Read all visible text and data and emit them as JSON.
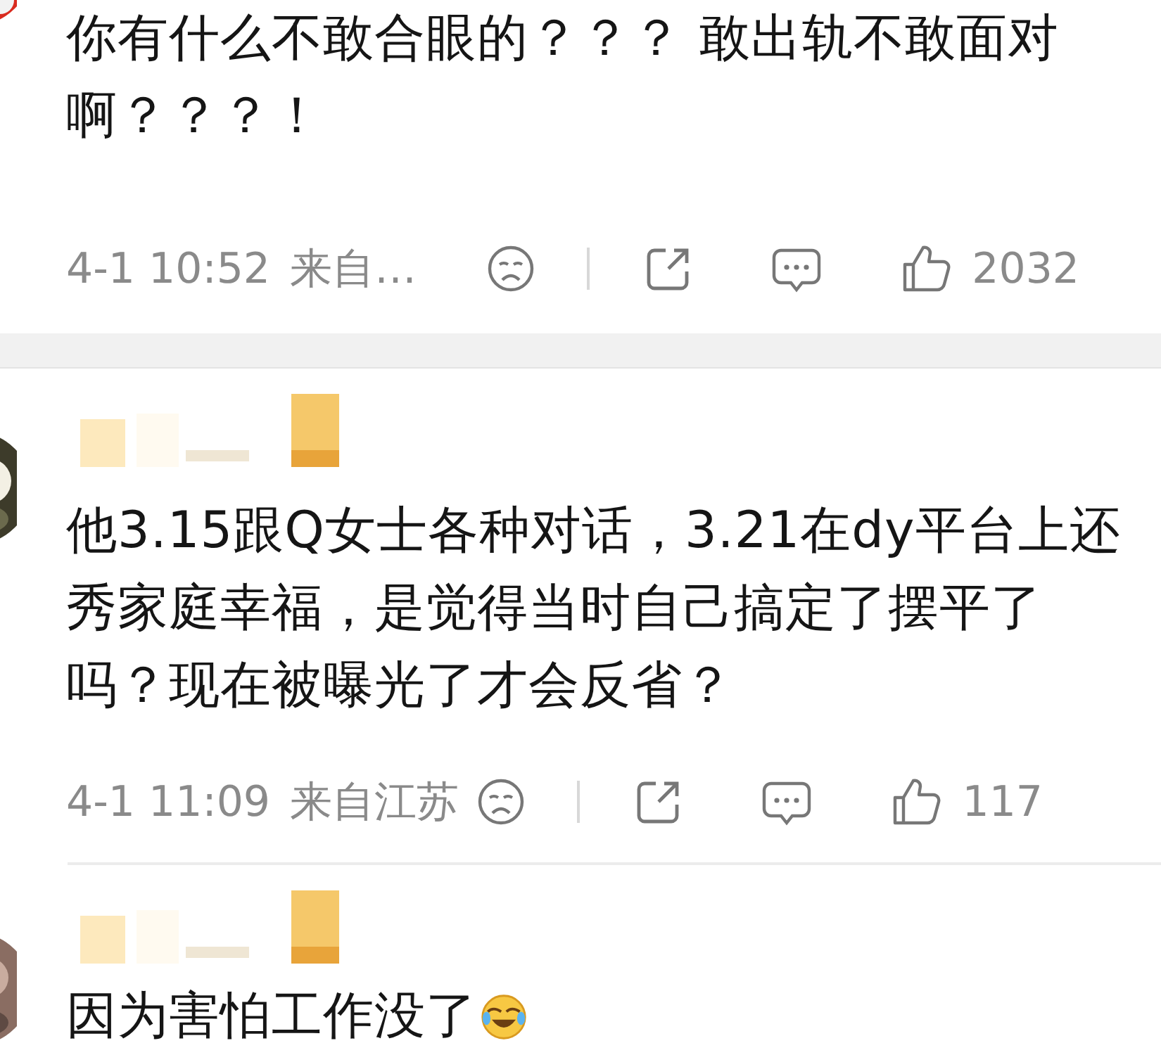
{
  "comments": [
    {
      "name_hidden": false,
      "text": "你有什么不敢合眼的？？？ 敢出轨不敢面对啊？？？！",
      "trailing_emoji": false,
      "meta": {
        "time": "4-1 10:52",
        "source": "来自…",
        "likes": "2032"
      }
    },
    {
      "name_hidden": true,
      "text": "他3.15跟Q女士各种对话，3.21在dy平台上还秀家庭幸福，是觉得当时自己搞定了摆平了吗？现在被曝光了才会反省？",
      "trailing_emoji": false,
      "meta": {
        "time": "4-1 11:09",
        "source": "来自江苏",
        "likes": "117"
      }
    },
    {
      "name_hidden": true,
      "text": "因为害怕工作没了",
      "trailing_emoji": true
    }
  ]
}
